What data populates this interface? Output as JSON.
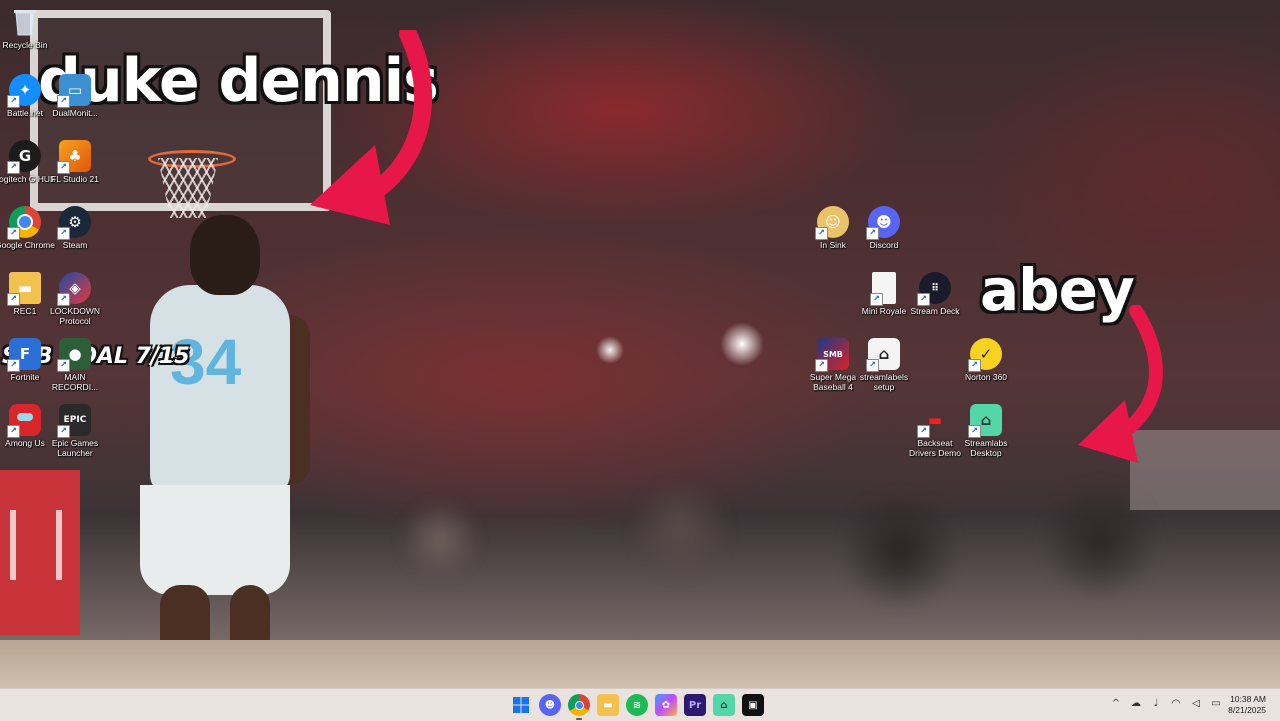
{
  "overlays": {
    "streamer_left": "duke dennis",
    "streamer_right": "abey",
    "sub_goal": "SUB GOAL 7/15"
  },
  "desktop_icons": [
    {
      "label": "Recycle Bin",
      "icon": "recycle-bin-icon"
    },
    {
      "label": "Battle.net",
      "icon": "battle-net-icon"
    },
    {
      "label": "DualMonit...",
      "icon": "dual-monitor-icon"
    },
    {
      "label": "Logitech G HUB",
      "icon": "logitech-ghub-icon"
    },
    {
      "label": "FL Studio 21",
      "icon": "fl-studio-icon"
    },
    {
      "label": "Google Chrome",
      "icon": "chrome-icon"
    },
    {
      "label": "Steam",
      "icon": "steam-icon"
    },
    {
      "label": "REC1",
      "icon": "folder-icon"
    },
    {
      "label": "LOCKDOWN Protocol",
      "icon": "lockdown-protocol-icon"
    },
    {
      "label": "Fortnite",
      "icon": "fortnite-icon"
    },
    {
      "label": "MAIN RECORDI...",
      "icon": "recording-icon"
    },
    {
      "label": "Among Us",
      "icon": "among-us-icon"
    },
    {
      "label": "Epic Games Launcher",
      "icon": "epic-games-icon"
    },
    {
      "label": "In Sink",
      "icon": "in-sink-icon"
    },
    {
      "label": "Discord",
      "icon": "discord-icon"
    },
    {
      "label": "Mini Royale",
      "icon": "file-icon"
    },
    {
      "label": "Stream Deck",
      "icon": "stream-deck-icon"
    },
    {
      "label": "Super Mega Baseball 4",
      "icon": "super-mega-baseball-icon"
    },
    {
      "label": "streamlabels setup",
      "icon": "streamlabels-icon"
    },
    {
      "label": "Norton 360",
      "icon": "norton-icon"
    },
    {
      "label": "Backseat Drivers Demo",
      "icon": "backseat-drivers-icon"
    },
    {
      "label": "Streamlabs Desktop",
      "icon": "streamlabs-icon"
    }
  ],
  "icon_glyphs": {
    "SMB": "SMB",
    "EPIC": "EPIC"
  },
  "taskbar": {
    "pinned": [
      {
        "name": "start-button",
        "icon": "windows-start-icon"
      },
      {
        "name": "taskbar-discord",
        "icon": "discord-icon"
      },
      {
        "name": "taskbar-chrome",
        "icon": "chrome-icon",
        "active": true
      },
      {
        "name": "taskbar-file-explorer",
        "icon": "folder-icon"
      },
      {
        "name": "taskbar-spotify",
        "icon": "spotify-icon"
      },
      {
        "name": "taskbar-copilot",
        "icon": "copilot-icon"
      },
      {
        "name": "taskbar-premiere-pro",
        "icon": "premiere-pro-icon",
        "glyph": "Pr"
      },
      {
        "name": "taskbar-streamlabs",
        "icon": "streamlabs-icon"
      },
      {
        "name": "taskbar-capcut",
        "icon": "capcut-icon"
      }
    ],
    "time": "10:38 AM",
    "date": "8/21/2025"
  },
  "colors": {
    "arrow": "#e8174a",
    "discord": "#5865f2",
    "streamlabs": "#53d6a8",
    "norton": "#f7d21f",
    "premiere": "#2b1a6e",
    "spotify": "#1db954",
    "taskbar": "#e9e2de"
  }
}
